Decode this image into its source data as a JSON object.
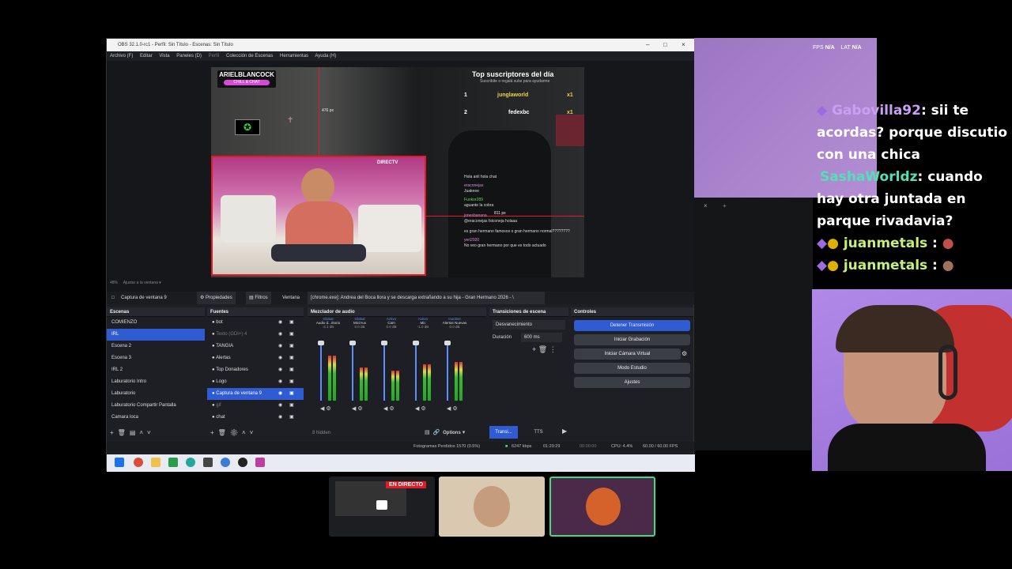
{
  "obs": {
    "title": "OBS 32.1.0-rc1 - Perfil: Sin Título - Escenas: Sin Título",
    "menu": [
      "Archivo (F)",
      "Editar",
      "Vista",
      "Paneles (D)",
      "Perfil",
      "Colección de Escenas",
      "Herramientas",
      "Ayuda (H)"
    ],
    "overlay": {
      "brand_name": "ARIELBLANCOCK",
      "brand_sub": "CHILL & CHAT",
      "height_label": "476 px",
      "width_label": "811 px",
      "directv": "DIRECTV",
      "top_title": "Top suscriptores del día",
      "top_sub": "Suscribite o regalá subs para ayudarme",
      "top_rows": [
        {
          "rank": "1",
          "name": "junglaworld",
          "count": "x1"
        },
        {
          "rank": "2",
          "name": "fedexbc",
          "count": "x1"
        }
      ],
      "mini_chat": [
        {
          "user": "",
          "text": "Hola ariil hola chat"
        },
        {
          "user": "eraconejas",
          "text": "Juakeee"
        },
        {
          "user": "Funkor289",
          "text": "aguante la cobra"
        },
        {
          "user": "jonesbanana",
          "text": "@eraconejas fsiconeja holaaa"
        },
        {
          "user": "",
          "text": "es gran hermano famosos o gran hermano normal????????"
        },
        {
          "user": "yeri2920",
          "text": "No veo gran hermano por que es todo actuado"
        }
      ]
    },
    "preview_toolbar": {
      "zoom": "48%",
      "fit": "Ajustar a la ventana"
    },
    "source_bar": {
      "selected": "Captura de ventana 9",
      "props": "Propiedades",
      "filters": "Filtros",
      "window_label": "Ventana",
      "window_value": "[chrome.exe]: Andrea del Boca llora y se descarga extrañando a su hija - Gran Hermano 2026 - \\"
    },
    "scenes": {
      "title": "Escenas",
      "items": [
        "COMIENZO",
        "IRL",
        "Escena 2",
        "Escena 3",
        "IRL 2",
        "Laburatorio Intro",
        "Laburatorio",
        "Laburatorio Compartir Pantalla",
        "Camara loca"
      ],
      "selected": 1
    },
    "sources": {
      "title": "Fuentes",
      "items": [
        "bot",
        "Texto (GDI+) 4",
        "TANGIA",
        "Alertas",
        "Top Donadores",
        "Logo",
        "Captura de ventana 9",
        "gif",
        "chat"
      ],
      "selected": 6
    },
    "mixer": {
      "title": "Mezclador de audio",
      "channels": [
        {
          "tag": "Global",
          "name": "Audio d...ritorio",
          "db": "-2.1 dB",
          "level": 0.75
        },
        {
          "tag": "Global",
          "name": "Mic/Aux",
          "db": "0.0 dB",
          "level": 0.55
        },
        {
          "tag": "Activo",
          "name": "Cam",
          "db": "0.0 dB",
          "level": 0.5
        },
        {
          "tag": "Activo",
          "name": "Mic",
          "db": "-1.0 dB",
          "level": 0.6
        },
        {
          "tag": "Inactive",
          "name": "Alertas Nuevas",
          "db": "0.0 dB",
          "level": 0.65
        }
      ],
      "hidden": "8 hidden",
      "options": "Options"
    },
    "transitions": {
      "title": "Transiciones de escena",
      "type": "Desvanecimiento",
      "duration_label": "Duración",
      "duration_value": "600 ms"
    },
    "controls": {
      "title": "Controles",
      "buttons": [
        "Detener Transmisión",
        "Iniciar Grabación",
        "Iniciar Cámara Virtual",
        "Modo Estudio",
        "Ajustes"
      ]
    },
    "bottom_tabs": {
      "trans": "Transi...",
      "tts": "TTS"
    },
    "status": {
      "dropped": "Fotogramas Perdidos 1570 (0.5%)",
      "bitrate": "6247 kbps",
      "stream_time": "01:29:29",
      "rec_time": "00:00:00",
      "cpu": "CPU: 4.4%",
      "fps": "60.00 / 60.00 FPS"
    }
  },
  "stats": {
    "fps_label": "FPS",
    "fps_value": "N/A",
    "lat_label": "LAT",
    "lat_value": "N/A"
  },
  "chat": [
    {
      "user": "Gabovilla92",
      "color": "#c7a0f5",
      "text": ": sii te acordas? porque discutio con una chica"
    },
    {
      "user": "SashaWorldz",
      "color": "#54e0b6",
      "text": ": cuando hay otra juntada en parque rivadavia?"
    },
    {
      "user": "juanmetals",
      "color": "#c7f07a",
      "text": " :"
    },
    {
      "user": "juanmetals",
      "color": "#c7f07a",
      "text": " :"
    }
  ],
  "thumb_live": "EN DIRECTO",
  "colors": {
    "accent": "#2f5bd3",
    "red": "#e01b24",
    "purple_bg": "#a682c8",
    "green_border": "#3ddc84"
  }
}
